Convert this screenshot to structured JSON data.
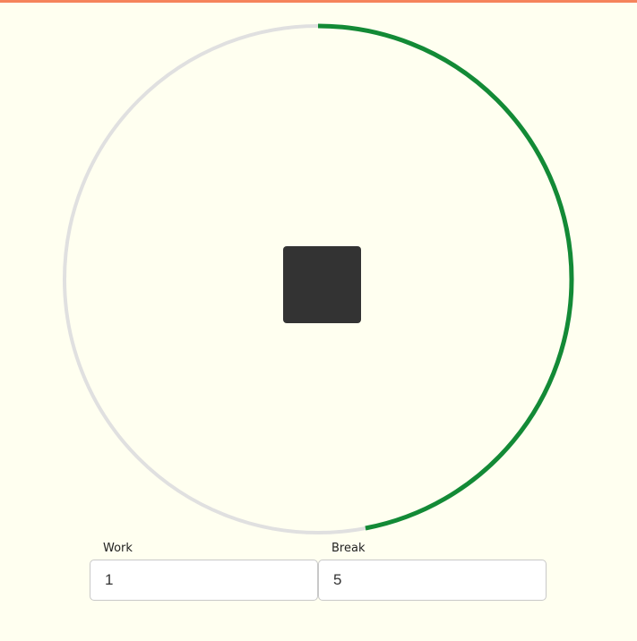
{
  "theme": {
    "background": "#FFFFF0",
    "top_bar": "#F5845C",
    "ring_track": "#E0E0E0",
    "ring_progress": "#138A36",
    "button": "#333333"
  },
  "timer": {
    "progress_fraction": 0.47,
    "state_icon": "stop-icon"
  },
  "work": {
    "label": "Work",
    "value": "1"
  },
  "break": {
    "label": "Break",
    "value": "5"
  }
}
